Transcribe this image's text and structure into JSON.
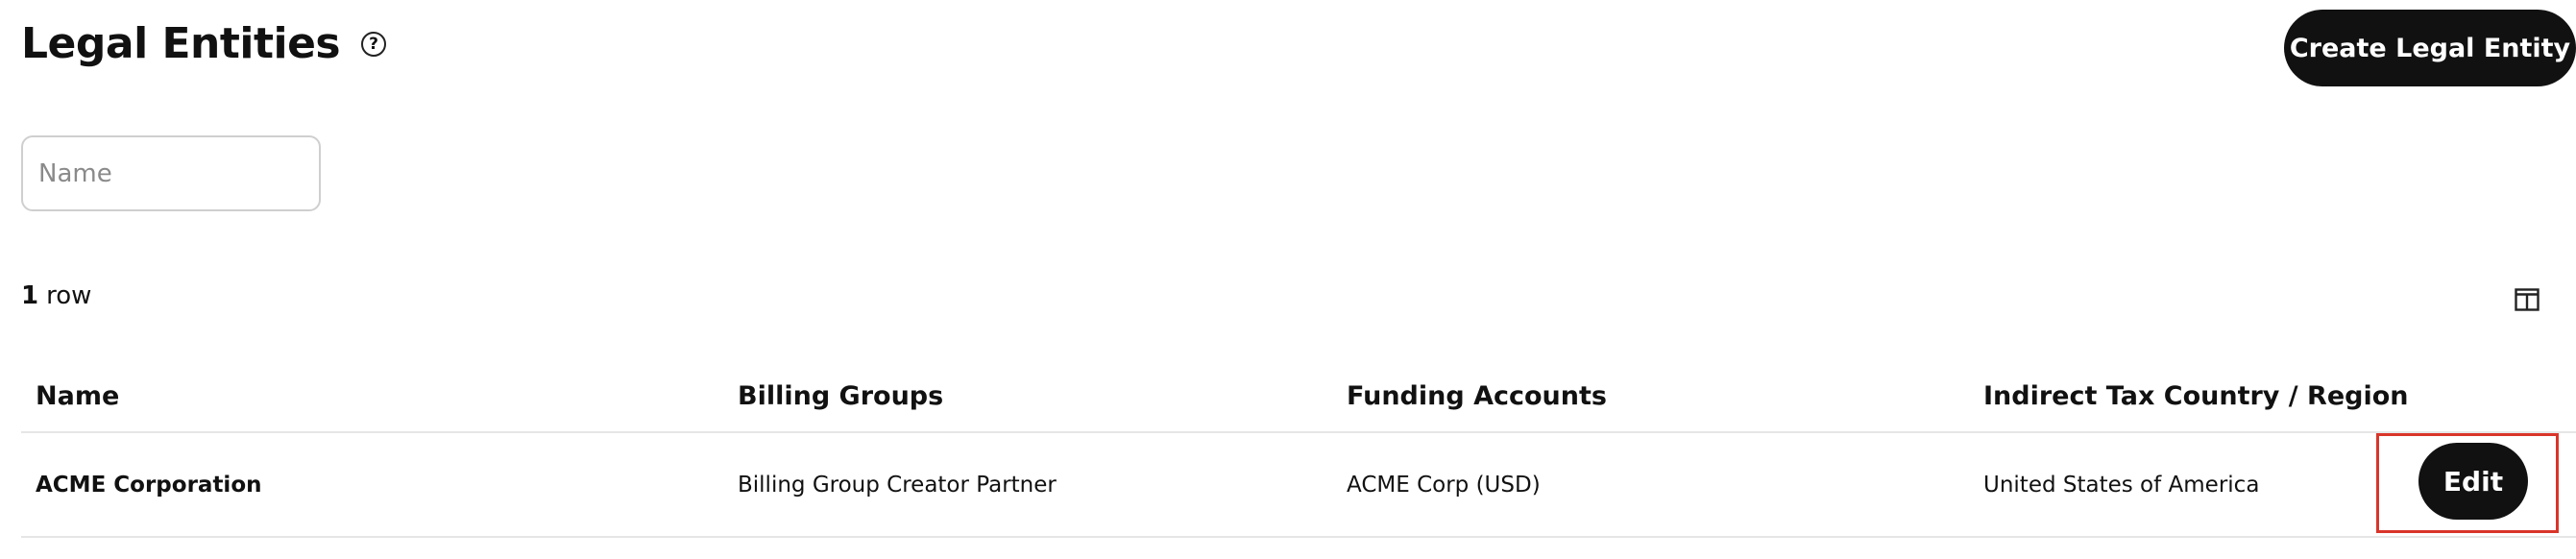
{
  "header": {
    "title": "Legal Entities",
    "help_glyph": "?",
    "help_icon": "question-circle-icon",
    "create_label": "Create Legal Entity"
  },
  "filters": {
    "name_placeholder": "Name",
    "name_value": ""
  },
  "summary": {
    "row_count": "1",
    "row_label": "row",
    "columns_icon": "columns-layout-icon"
  },
  "table": {
    "columns": [
      "Name",
      "Billing Groups",
      "Funding Accounts",
      "Indirect Tax Country / Region"
    ],
    "rows": [
      {
        "name": "ACME Corporation",
        "billing_groups": "Billing Group Creator Partner",
        "funding_accounts": "ACME Corp (USD)",
        "tax_region": "United States of America",
        "action_label": "Edit"
      }
    ]
  },
  "colors": {
    "primary_button": "#111111",
    "highlight": "#d9352a",
    "border": "#e6e6e6"
  }
}
